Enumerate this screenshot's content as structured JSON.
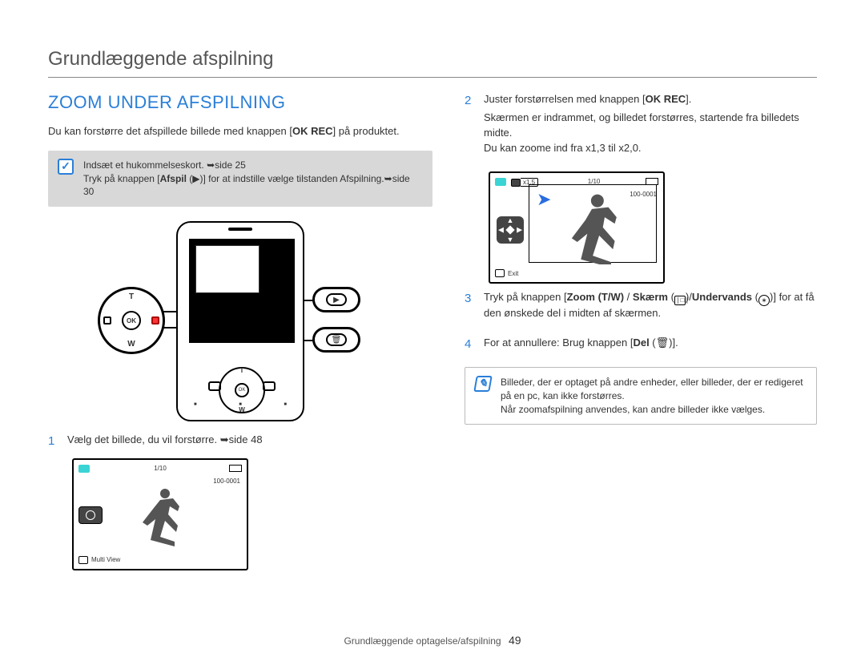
{
  "header": {
    "title": "Grundlæggende afspilning"
  },
  "section": {
    "heading": "ZOOM UNDER AFSPILNING"
  },
  "intro": {
    "prefix": "Du kan forstørre det afspillede billede med knappen [",
    "button": "OK REC",
    "suffix": "] på produktet."
  },
  "preNote": {
    "line1_a": "Indsæt et hukommelseskort. ",
    "line1_ref": "➥side 25",
    "line2_a": "Tryk på knappen [",
    "line2_bold": "Afspil",
    "line2_b": " (▶)] for at indstille vælge tilstanden Afspilning.",
    "line2_ref": "➥side 30"
  },
  "dpad": {
    "t": "T",
    "w": "W",
    "ok": "OK"
  },
  "steps": {
    "s1": {
      "num": "1",
      "text_a": "Vælg det billede, du vil forstørre.  ",
      "text_ref": "➥side 48"
    },
    "s2": {
      "num": "2",
      "text_a": "Juster forstørrelsen med knappen [",
      "text_bold": "OK REC",
      "text_b": "].",
      "extra1": "Skærmen er indrammet, og billedet forstørres, startende fra billedets midte.",
      "extra2": "Du kan zoome ind fra x1,3 til x2,0."
    },
    "s3": {
      "num": "3",
      "text_a": "Tryk på knappen [",
      "bold1": "Zoom (T/W)",
      "sep1": " / ",
      "bold2": "Skærm",
      "sep2": " (",
      "sep2b": ")/",
      "bold3": "Undervands",
      "sep3a": " (",
      "sep3b": ")]",
      "tail": " for at få den ønskede del i midten af skærmen."
    },
    "s4": {
      "num": "4",
      "text_a": "For at annullere: Brug knappen [",
      "bold": "Del",
      "text_b": " (🗑)]."
    }
  },
  "screenshot1": {
    "count": "1/10",
    "fileno": "100-0001",
    "bl_label": "Multi View"
  },
  "screenshot2": {
    "zoom": "x1.5",
    "count": "1/10",
    "fileno": "100-0001",
    "bl_label": "Exit"
  },
  "tip": {
    "line1": "Billeder, der er optaget på andre enheder, eller billeder, der er redigeret på en pc, kan ikke forstørres.",
    "line2": "Når zoomafspilning anvendes, kan andre billeder ikke vælges."
  },
  "footer": {
    "section": "Grundlæggende optagelse/afspilning",
    "page": "49"
  }
}
